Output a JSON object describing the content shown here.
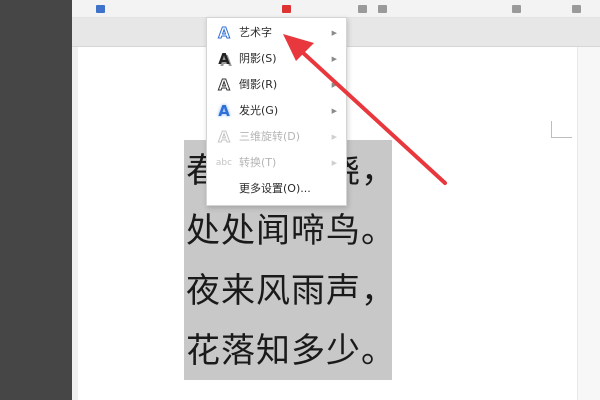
{
  "menu": {
    "items": [
      {
        "label": "艺术字",
        "icon": "A",
        "has_submenu": true,
        "enabled": true
      },
      {
        "label": "阴影(S)",
        "icon": "A",
        "has_submenu": true,
        "enabled": true
      },
      {
        "label": "倒影(R)",
        "icon": "A",
        "has_submenu": true,
        "enabled": true
      },
      {
        "label": "发光(G)",
        "icon": "A",
        "has_submenu": true,
        "enabled": true
      },
      {
        "label": "三维旋转(D)",
        "icon": "A",
        "has_submenu": true,
        "enabled": false
      },
      {
        "label": "转换(T)",
        "icon": "abc",
        "has_submenu": true,
        "enabled": false
      },
      {
        "label": "更多设置(O)...",
        "icon": "",
        "has_submenu": false,
        "enabled": true
      }
    ],
    "submenu_arrow": "▶"
  },
  "document": {
    "poem_lines": [
      "春眠不觉晓，",
      "处处闻啼鸟。",
      "夜来风雨声，",
      "花落知多少。"
    ]
  },
  "colors": {
    "selection": "#c8c8c8",
    "annotation_arrow": "#e8383d",
    "icon_outline": "#2f6fd6"
  }
}
